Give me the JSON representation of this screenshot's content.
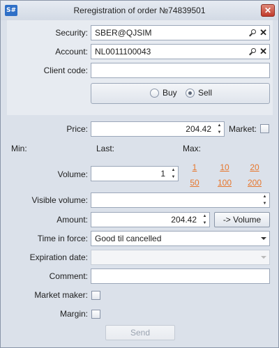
{
  "window": {
    "app_icon_text": "S#",
    "title": "Reregistration of order №74839501",
    "close_glyph": "✕"
  },
  "form": {
    "security": {
      "label": "Security:",
      "value": "SBER@QJSIM"
    },
    "account": {
      "label": "Account:",
      "value": "NL0011100043"
    },
    "client_code": {
      "label": "Client code:",
      "value": ""
    },
    "side": {
      "options": [
        "Buy",
        "Sell"
      ],
      "selected": "Sell"
    },
    "price": {
      "label": "Price:",
      "value": "204.42"
    },
    "market": {
      "label": "Market:",
      "checked": false
    },
    "min_label": "Min:",
    "last_label": "Last:",
    "max_label": "Max:",
    "volume": {
      "label": "Volume:",
      "value": "1"
    },
    "quick_volumes": [
      "1",
      "10",
      "20",
      "50",
      "100",
      "200"
    ],
    "visible_volume": {
      "label": "Visible volume:",
      "value": ""
    },
    "amount": {
      "label": "Amount:",
      "value": "204.42",
      "button": "-> Volume"
    },
    "time_in_force": {
      "label": "Time in force:",
      "value": "Good til cancelled"
    },
    "expiration_date": {
      "label": "Expiration date:",
      "value": ""
    },
    "comment": {
      "label": "Comment:",
      "value": ""
    },
    "market_maker": {
      "label": "Market maker:",
      "checked": false
    },
    "margin": {
      "label": "Margin:",
      "checked": false
    },
    "send_button": "Send"
  },
  "icons": {
    "search": "search-icon",
    "clear": "clear-icon",
    "spin_up": "▲",
    "spin_down": "▼"
  },
  "colors": {
    "link": "#e7772d",
    "close": "#c0392b",
    "app_icon": "#2e6fc7"
  }
}
